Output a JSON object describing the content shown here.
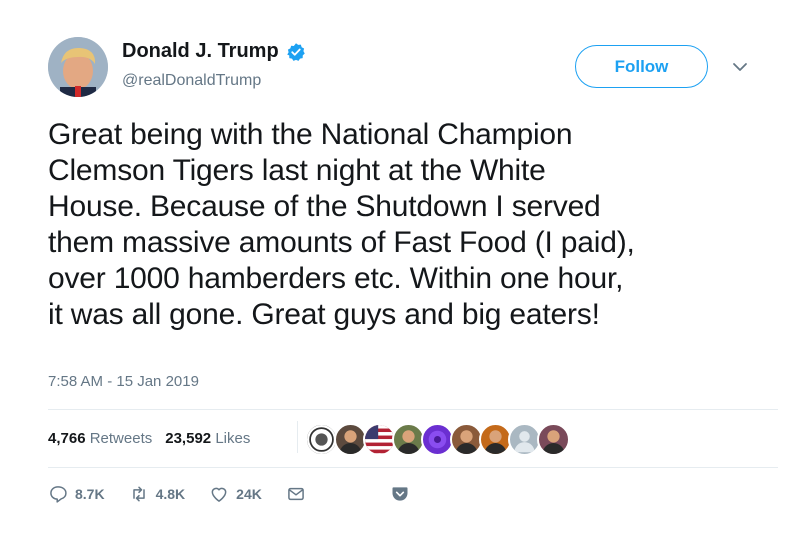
{
  "user": {
    "display_name": "Donald J. Trump",
    "handle": "@realDonaldTrump",
    "verified": true
  },
  "follow_label": "Follow",
  "tweet": {
    "lines": [
      "Great being with the National Champion",
      "Clemson Tigers last night at the White",
      "House. Because of the Shutdown I served",
      "them massive amounts of Fast Food (I paid),",
      "over 1000 hamberders etc. Within one hour,",
      "it was all gone. Great guys and big eaters!"
    ],
    "timestamp": "7:58 AM - 15 Jan 2019"
  },
  "stats": {
    "retweets_count": "4,766",
    "retweets_label": "Retweets",
    "likes_count": "23,592",
    "likes_label": "Likes"
  },
  "likers": [
    {
      "icon": "seal-avatar",
      "color": "#3a3a3a"
    },
    {
      "icon": "person-avatar",
      "color": "#5c4a3e"
    },
    {
      "icon": "flag-avatar",
      "color": "#b22234"
    },
    {
      "icon": "person-avatar",
      "color": "#6b7b4a"
    },
    {
      "icon": "purple-avatar",
      "color": "#6b2fd1"
    },
    {
      "icon": "person-avatar",
      "color": "#8a5a3a"
    },
    {
      "icon": "person-avatar",
      "color": "#c46a1a"
    },
    {
      "icon": "default-avatar",
      "color": "#aab8c2"
    },
    {
      "icon": "person-avatar",
      "color": "#7a4a5a"
    }
  ],
  "actions": {
    "replies": "8.7K",
    "retweets": "4.8K",
    "likes": "24K"
  },
  "colors": {
    "accent": "#1da1f2",
    "secondary_text": "#657786",
    "divider": "#e6ecf0"
  }
}
